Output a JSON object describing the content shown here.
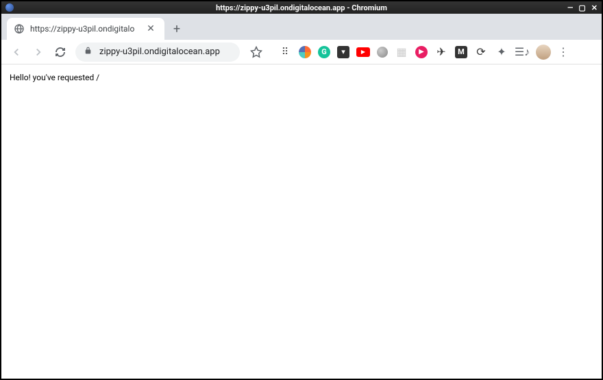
{
  "window": {
    "title": "https://zippy-u3pil.ondigitalocean.app - Chromium"
  },
  "tab": {
    "title": "https://zippy-u3pil.ondigitalo"
  },
  "address": {
    "url": "zippy-u3pil.ondigitalocean.app"
  },
  "page": {
    "body_text": "Hello! you've requested /"
  }
}
